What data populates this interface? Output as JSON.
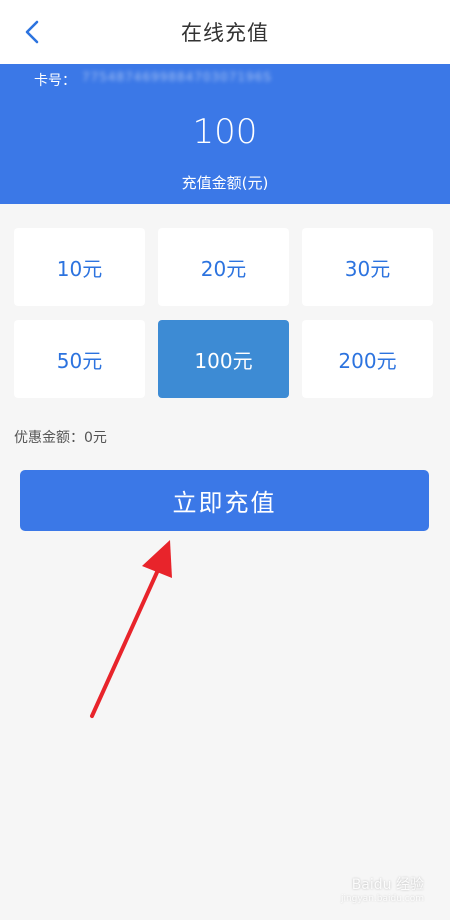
{
  "nav": {
    "title": "在线充值",
    "back_icon": "chevron-left-icon"
  },
  "header": {
    "card_label": "卡号：",
    "card_number": "775487469988470307196S",
    "amount": "100",
    "amount_label": "充值金额(元)"
  },
  "options": [
    {
      "label": "10元",
      "selected": false
    },
    {
      "label": "20元",
      "selected": false
    },
    {
      "label": "30元",
      "selected": false
    },
    {
      "label": "50元",
      "selected": false
    },
    {
      "label": "100元",
      "selected": true
    },
    {
      "label": "200元",
      "selected": false
    }
  ],
  "discount_text": "优惠金额：0元",
  "submit_label": "立即充值",
  "watermark": {
    "main": "Baidu 经验",
    "sub": "jingyan.baidu.com"
  },
  "colors": {
    "primary": "#3b78e7",
    "selected_option": "#3d8bd4",
    "option_text": "#2c73df",
    "annotation_arrow": "#e8242b"
  }
}
